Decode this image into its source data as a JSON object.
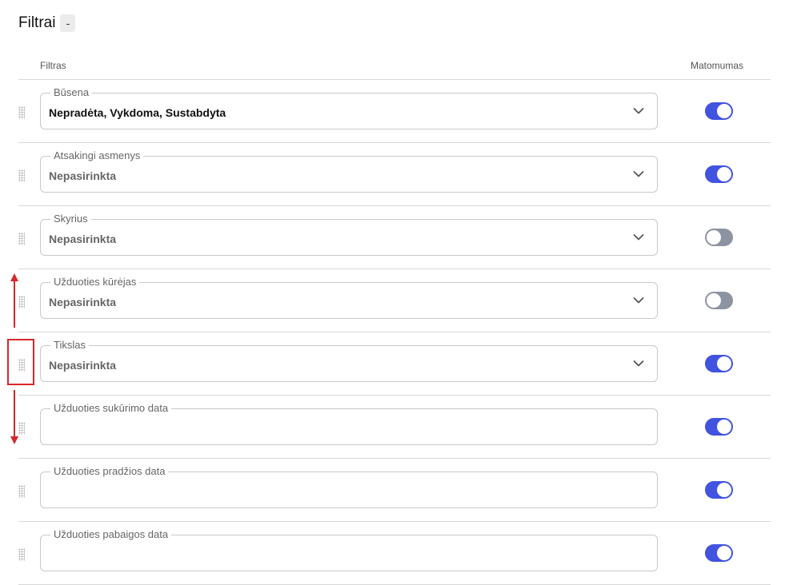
{
  "header": {
    "title": "Filtrai",
    "collapse_label": "-"
  },
  "columns": {
    "filter": "Filtras",
    "visibility": "Matomumas"
  },
  "accent_color": "#4253e0",
  "rows": [
    {
      "label": "Būsena",
      "value": "Nepradėta, Vykdoma, Sustabdyta",
      "has_dropdown": true,
      "visible": true
    },
    {
      "label": "Atsakingi asmenys",
      "value": "Nepasirinkta",
      "has_dropdown": true,
      "visible": true
    },
    {
      "label": "Skyrius",
      "value": "Nepasirinkta",
      "has_dropdown": true,
      "visible": false
    },
    {
      "label": "Užduoties kūrėjas",
      "value": "Nepasirinkta",
      "has_dropdown": true,
      "visible": false
    },
    {
      "label": "Tikslas",
      "value": "Nepasirinkta",
      "has_dropdown": true,
      "visible": true
    },
    {
      "label": "Užduoties sukūrimo data",
      "value": "",
      "has_dropdown": false,
      "visible": true
    },
    {
      "label": "Užduoties pradžios data",
      "value": "",
      "has_dropdown": false,
      "visible": true
    },
    {
      "label": "Užduoties pabaigos data",
      "value": "",
      "has_dropdown": false,
      "visible": true
    }
  ]
}
